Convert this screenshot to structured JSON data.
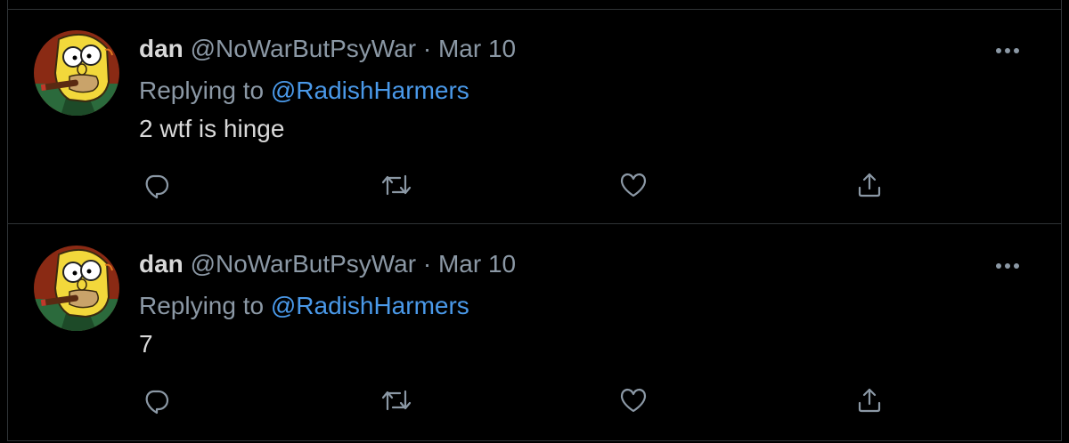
{
  "colors": {
    "background": "#000000",
    "divider": "#2f3336",
    "primary_text": "#d9d9d9",
    "secondary_text": "#8b98a5",
    "link": "#4a99e9"
  },
  "tweets": [
    {
      "display_name": "dan",
      "handle": "@NoWarButPsyWar",
      "separator": "·",
      "date": "Mar 10",
      "replying_prefix": "Replying to",
      "replying_to": "@RadishHarmers",
      "text": "2 wtf is hinge",
      "avatar_icon": "homer-simpson-avatar",
      "more_icon": "more-horizontal-icon",
      "action_icons": [
        "reply-icon",
        "retweet-icon",
        "like-icon",
        "share-icon"
      ]
    },
    {
      "display_name": "dan",
      "handle": "@NoWarButPsyWar",
      "separator": "·",
      "date": "Mar 10",
      "replying_prefix": "Replying to",
      "replying_to": "@RadishHarmers",
      "text": "7",
      "avatar_icon": "homer-simpson-avatar",
      "more_icon": "more-horizontal-icon",
      "action_icons": [
        "reply-icon",
        "retweet-icon",
        "like-icon",
        "share-icon"
      ]
    }
  ]
}
